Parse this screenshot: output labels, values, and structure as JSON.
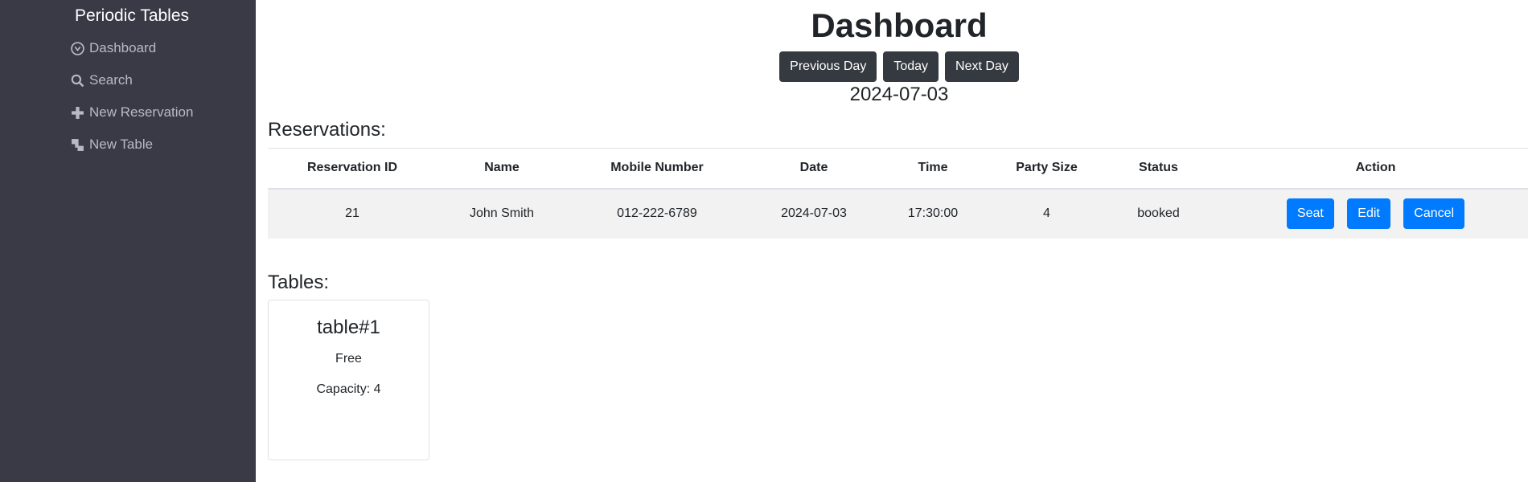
{
  "sidebar": {
    "brand": "Periodic Tables",
    "items": [
      {
        "label": "Dashboard",
        "icon": "dashboard-icon"
      },
      {
        "label": "Search",
        "icon": "search-icon"
      },
      {
        "label": "New Reservation",
        "icon": "plus-icon"
      },
      {
        "label": "New Table",
        "icon": "layers-icon"
      }
    ]
  },
  "header": {
    "title": "Dashboard",
    "prev_label": "Previous Day",
    "today_label": "Today",
    "next_label": "Next Day",
    "date": "2024-07-03"
  },
  "reservations": {
    "heading": "Reservations:",
    "columns": [
      "Reservation ID",
      "Name",
      "Mobile Number",
      "Date",
      "Time",
      "Party Size",
      "Status",
      "Action"
    ],
    "rows": [
      {
        "id": "21",
        "name": "John Smith",
        "mobile": "012-222-6789",
        "date": "2024-07-03",
        "time": "17:30:00",
        "party_size": "4",
        "status": "booked",
        "actions": {
          "seat": "Seat",
          "edit": "Edit",
          "cancel": "Cancel"
        }
      }
    ]
  },
  "tables": {
    "heading": "Tables:",
    "items": [
      {
        "name": "table#1",
        "status": "Free",
        "capacity": "Capacity: 4"
      }
    ]
  },
  "colors": {
    "sidebar_bg": "#3a3a47",
    "primary": "#007bff",
    "dark": "#343a40"
  }
}
